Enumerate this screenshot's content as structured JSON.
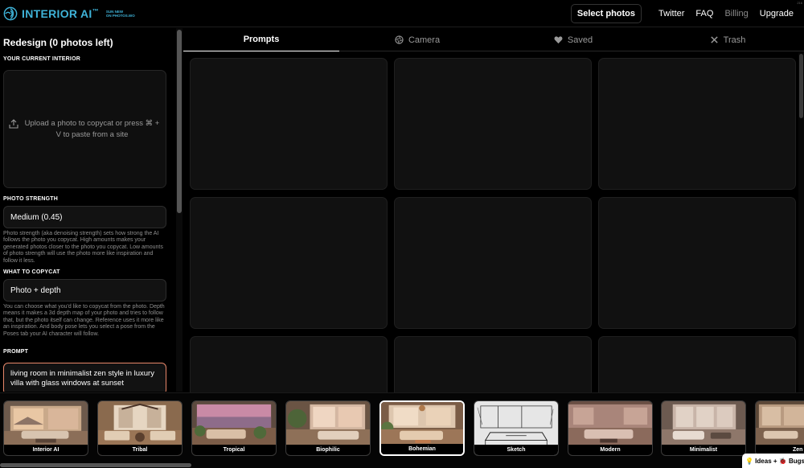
{
  "header": {
    "logo_text": "INTERIOR AI",
    "logo_tm": "™",
    "logo_sub_line1": "SUN NEW",
    "logo_sub_line2": "ON PHOTOS.WO",
    "corner_mark": "216",
    "select_photos": "Select photos",
    "nav": {
      "twitter": "Twitter",
      "faq": "FAQ",
      "billing": "Billing",
      "upgrade": "Upgrade"
    }
  },
  "sidebar": {
    "title": "Redesign (0 photos left)",
    "current_interior_label": "YOUR CURRENT INTERIOR",
    "upload_text": "Upload a photo to copycat or press ⌘ + V to paste from a site",
    "photo_strength_label": "PHOTO STRENGTH",
    "photo_strength_value": "Medium (0.45)",
    "photo_strength_help": "Photo strength (aka denoising strength) sets how strong the AI follows the photo you copycat. High amounts makes your generated photos closer to the photo you copycat. Low amounts of photo strength will use the photo more like inspiration and follow it less.",
    "copycat_label": "WHAT TO COPYCAT",
    "copycat_value": "Photo + depth",
    "copycat_help": "You can choose what you'd like to copycat from the photo. Depth means it makes a 3d depth map of your photo and tries to follow that, but the photo itself can change. Reference uses it more like an inspiration. And body pose lets you select a pose from the Poses tab your AI character will follow.",
    "prompt_label": "PROMPT",
    "prompt_value": "living room in minimalist zen style in luxury villa with glass windows at sunset"
  },
  "tabs": [
    {
      "label": "Prompts",
      "icon": "none",
      "active": true
    },
    {
      "label": "Camera",
      "icon": "camera-aperture-icon",
      "active": false
    },
    {
      "label": "Saved",
      "icon": "heart-icon",
      "active": false
    },
    {
      "label": "Trash",
      "icon": "close-icon",
      "active": false
    }
  ],
  "styles": [
    {
      "label": "Interior AI",
      "selected": false
    },
    {
      "label": "Tribal",
      "selected": false
    },
    {
      "label": "Tropical",
      "selected": false
    },
    {
      "label": "Biophilic",
      "selected": false
    },
    {
      "label": "Bohemian",
      "selected": true
    },
    {
      "label": "Sketch",
      "selected": false
    },
    {
      "label": "Modern",
      "selected": false
    },
    {
      "label": "Minimalist",
      "selected": false
    },
    {
      "label": "Zen",
      "selected": false
    }
  ],
  "feedback_badge": "💡 Ideas + 🐞 Bugs",
  "colors": {
    "accent_logo": "#3fb3d8",
    "prompt_border": "#e8876a"
  }
}
